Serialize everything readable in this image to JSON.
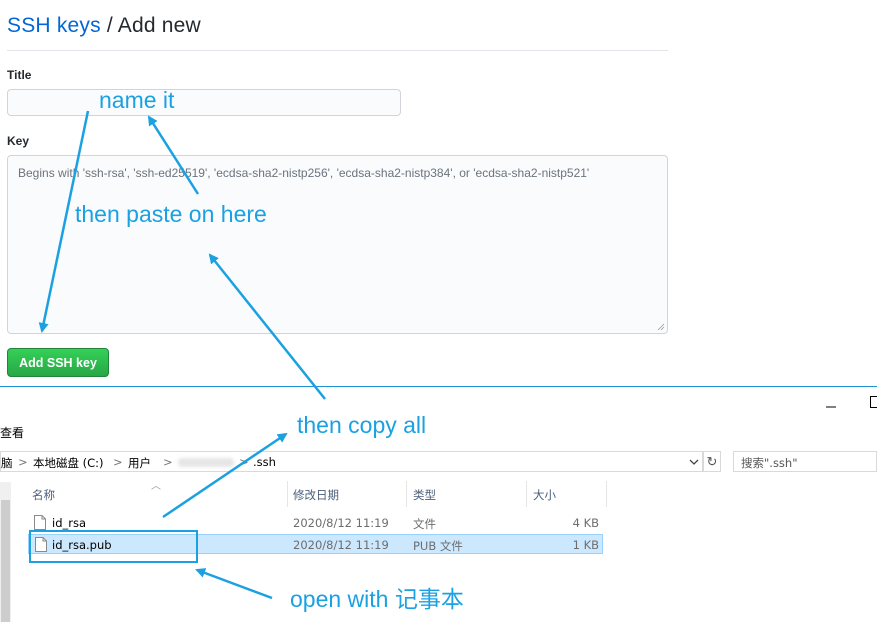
{
  "header": {
    "crumb_link": "SSH keys",
    "separator": "/",
    "current": "Add new"
  },
  "form": {
    "title_label": "Title",
    "title_value": "",
    "key_label": "Key",
    "key_placeholder": "Begins with 'ssh-rsa', 'ssh-ed25519', 'ecdsa-sha2-nistp256', 'ecdsa-sha2-nistp384', or 'ecdsa-sha2-nistp521'",
    "submit_label": "Add SSH key"
  },
  "explorer": {
    "menu_view": "查看",
    "breadcrumbs": [
      "脑",
      "本地磁盘 (C:)",
      "用户",
      ".ssh"
    ],
    "breadcrumb_separator": ">",
    "search_placeholder": "搜索\".ssh\"",
    "columns": [
      "名称",
      "修改日期",
      "类型",
      "大小"
    ],
    "files": [
      {
        "name": "id_rsa",
        "modified": "2020/8/12 11:19",
        "type": "文件",
        "size": "4 KB",
        "selected": false
      },
      {
        "name": "id_rsa.pub",
        "modified": "2020/8/12 11:19",
        "type": "PUB 文件",
        "size": "1 KB",
        "selected": true
      }
    ]
  },
  "annotations": {
    "name_it": "name it",
    "paste_here": "then paste on here",
    "copy_all": "then copy all",
    "open_with": "open with 记事本"
  },
  "colors": {
    "annotation": "#1ba1e2",
    "link": "#0366d6",
    "button": "#28a745",
    "selection": "#cce8ff"
  }
}
